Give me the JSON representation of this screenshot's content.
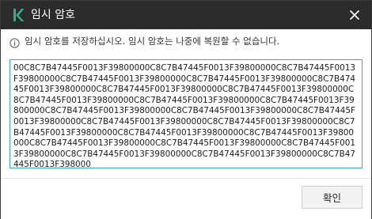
{
  "window": {
    "title": "임시 암호",
    "app_icon": "kaspersky-k-logo-icon",
    "close_icon": "close-icon"
  },
  "info": {
    "icon": "info-icon",
    "text": "임시 암호를 저장하십시오. 임시 암호는 나중에 복원할 수 없습니다."
  },
  "password": {
    "value": "00C8C7B47445F0013F39800000C8C7B47445F0013F39800000C8C7B47445F0013F39800000C8C7B47445F0013F39800000C8C7B47445F0013F39800000C8C7B47445F0013F39800000C8C7B47445F0013F39800000C8C7B47445F0013F39800000C8C7B47445F0013F39800000C8C7B47445F0013F39800000C8C7B47445F0013F39800000C8C7B47445F0013F39800000C8C7B47445F0013F39800000C8C7B47445F0013F39800000C8C7B47445F0013F39800000C8C7B47445F0013F39800000C8C7B47445F0013F39800000C8C7B47445F0013F39800000C8C7B47445F0013F39800000C8C7B47445F0013F39800000C8C7B47445F0013F39800000C8C7B47445F0013F39800000C8C7B47445F0013F39800000C8C7B47445F0013F39800000C8C7B47445F0013F398000"
  },
  "footer": {
    "ok_label": "확인"
  },
  "colors": {
    "titlebar_bg": "#2b2b2b",
    "brand_green": "#2fb08a",
    "focus_border": "#39a5c6"
  }
}
